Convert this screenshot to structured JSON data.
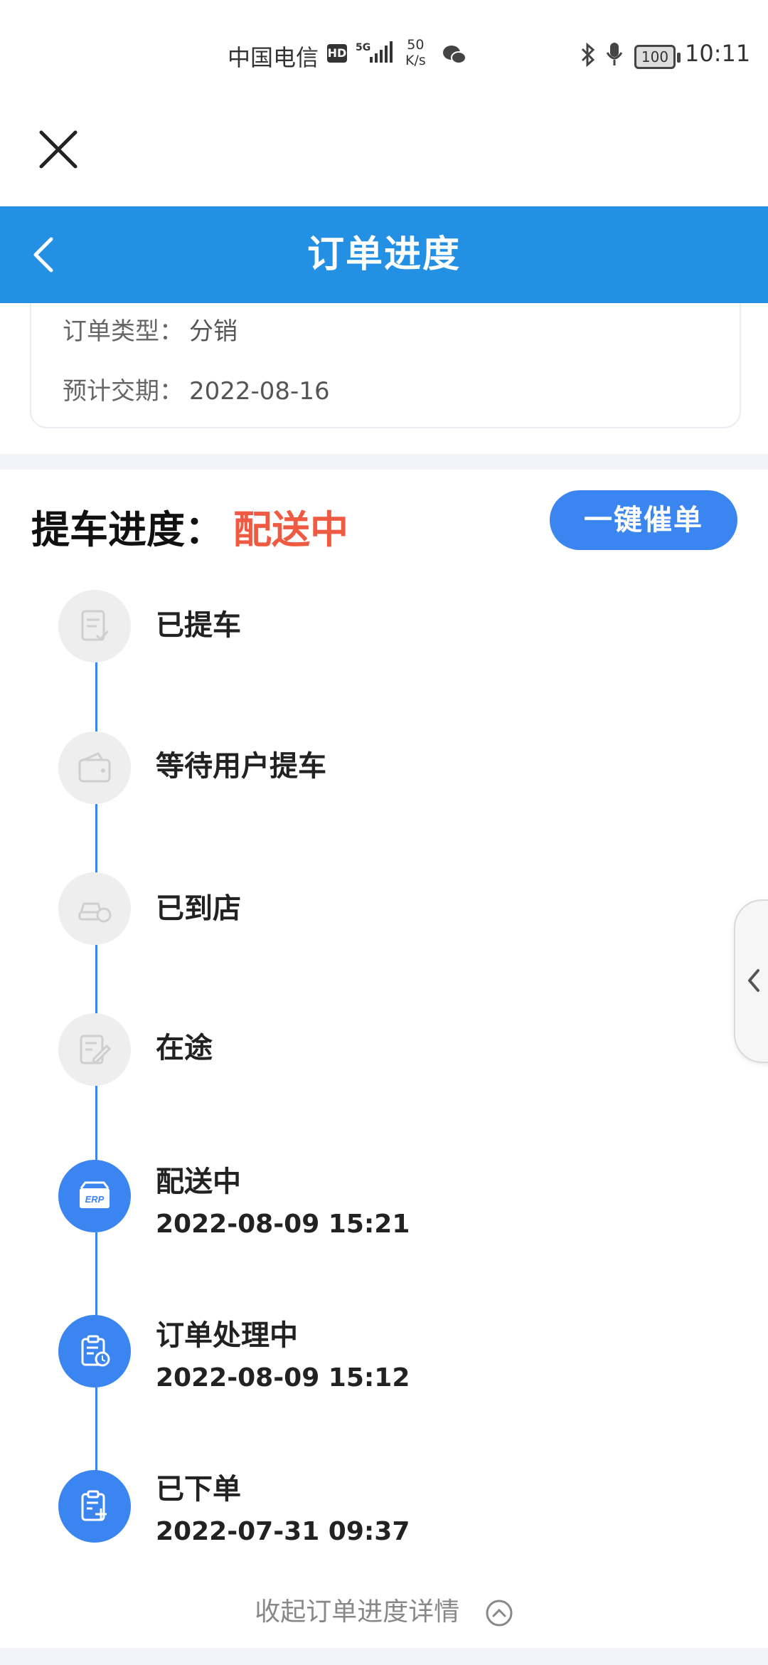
{
  "status_bar": {
    "carrier": "中国电信",
    "hd": "HD",
    "network": "5G",
    "speed_value": "50",
    "speed_unit": "K/s",
    "battery": "100",
    "time": "10:11"
  },
  "header": {
    "title": "订单进度"
  },
  "order_info": {
    "type_label": "订单类型：",
    "type_value": "分销",
    "delivery_label": "预计交期：",
    "delivery_value": "2022-08-16"
  },
  "progress": {
    "label": "提车进度：",
    "status": "配送中",
    "urge_button": "一键催单",
    "steps": [
      {
        "title": "已提车",
        "time": "",
        "icon": "checklist-icon",
        "active": false
      },
      {
        "title": "等待用户提车",
        "time": "",
        "icon": "wallet-icon",
        "active": false
      },
      {
        "title": "已到店",
        "time": "",
        "icon": "car-icon",
        "active": false
      },
      {
        "title": "在途",
        "time": "",
        "icon": "edit-note-icon",
        "active": false
      },
      {
        "title": "配送中",
        "time": "2022-08-09 15:21",
        "icon": "erp-box-icon",
        "active": true
      },
      {
        "title": "订单处理中",
        "time": "2022-08-09 15:12",
        "icon": "clipboard-clock-icon",
        "active": true
      },
      {
        "title": "已下单",
        "time": "2022-07-31 09:37",
        "icon": "clipboard-add-icon",
        "active": true
      }
    ],
    "collapse_label": "收起订单进度详情"
  },
  "colors": {
    "header_bg": "#2490e4",
    "accent_blue": "#3b85f0",
    "status_red": "#ee5a42",
    "inactive_grey": "#eeeeee"
  }
}
